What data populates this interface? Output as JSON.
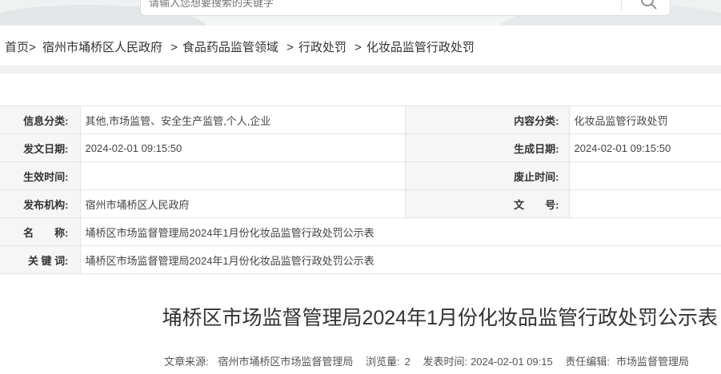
{
  "search": {
    "placeholder": "请输入您想要搜索的关键字",
    "button_icon": "search-icon"
  },
  "breadcrumb": {
    "items": [
      "首页",
      "宿州市埇桥区人民政府",
      "食品药品监管领域",
      "行政处罚",
      "化妆品监管行政处罚"
    ],
    "separator": ">"
  },
  "info": {
    "category_label": "信息分类:",
    "category_value": "其他,市场监管、安全生产监管,个人,企业",
    "content_label": "内容分类:",
    "content_value": "化妆品监管行政处罚",
    "issue_date_label": "发文日期:",
    "issue_date_value": "2024-02-01 09:15:50",
    "generate_date_label": "生成日期:",
    "generate_date_value": "2024-02-01 09:15:50",
    "effective_label": "生效时间:",
    "effective_value": "",
    "expire_label": "废止时间:",
    "expire_value": "",
    "org_label": "发布机构:",
    "org_value": "宿州市埇桥区人民政府",
    "doc_no_label": "文　　号:",
    "doc_no_value": "",
    "name_label": "名　　称:",
    "name_value": "埇桥区市场监督管理局2024年1月份化妆品监管行政处罚公示表",
    "keywords_label": "关 键 词:",
    "keywords_value": "埇桥区市场监督管理局2024年1月份化妆品监管行政处罚公示表"
  },
  "article": {
    "title": "埇桥区市场监督管理局2024年1月份化妆品监管行政处罚公示表",
    "source_label": "文章来源:",
    "source_value": "宿州市埇桥区市场监督管理局",
    "views_label": "浏览量:",
    "views_value": "2",
    "publish_label": "发表时间:",
    "publish_value": "2024-02-01 09:15",
    "editor_label": "责任编辑:",
    "editor_value": "市场监督管理局"
  }
}
